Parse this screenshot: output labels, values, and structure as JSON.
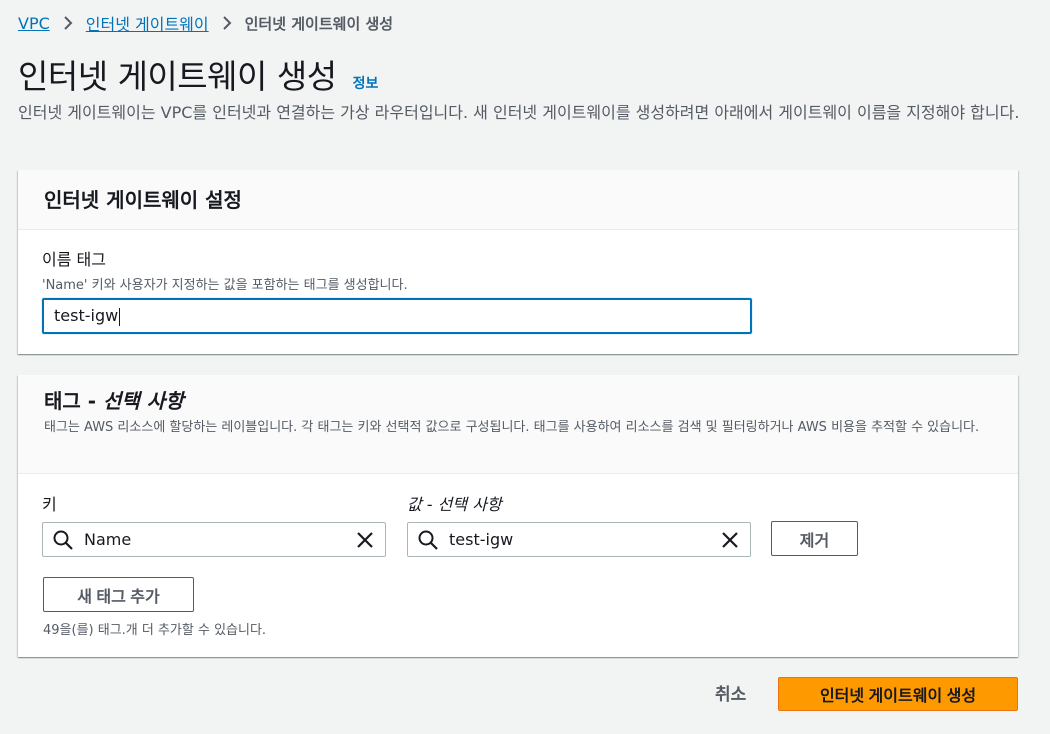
{
  "breadcrumb": {
    "items": [
      "VPC",
      "인터넷 게이트웨이"
    ],
    "current": "인터넷 게이트웨이 생성"
  },
  "page": {
    "title": "인터넷 게이트웨이 생성",
    "info_link": "정보",
    "description": "인터넷 게이트웨이는 VPC를 인터넷과 연결하는 가상 라우터입니다. 새 인터넷 게이트웨이를 생성하려면 아래에서 게이트웨이 이름을 지정해야 합니다."
  },
  "settings_panel": {
    "title": "인터넷 게이트웨이 설정",
    "name_tag_label": "이름 태그",
    "name_tag_hint": "'Name' 키와 사용자가 지정하는 값을 포함하는 태그를 생성합니다.",
    "name_tag_value": "test-igw"
  },
  "tags_panel": {
    "title_main": "태그 - ",
    "title_optional": "선택 사항",
    "description": "태그는 AWS 리소스에 할당하는 레이블입니다. 각 태그는 키와 선택적 값으로 구성됩니다. 태그를 사용하여 리소스를 검색 및 필터링하거나 AWS 비용을 추적할 수 있습니다.",
    "key_label": "키",
    "value_label": "값 - 선택 사항",
    "key_value": "Name",
    "value_value": "test-igw",
    "remove_button": "제거",
    "add_tag_button": "새 태그 추가",
    "remaining_hint": "49을(를) 태그.개 더 추가할 수 있습니다."
  },
  "footer": {
    "cancel": "취소",
    "create": "인터넷 게이트웨이 생성"
  },
  "colors": {
    "link": "#0073bb",
    "primary_button": "#ff9900",
    "focus_border": "#0073bb"
  }
}
